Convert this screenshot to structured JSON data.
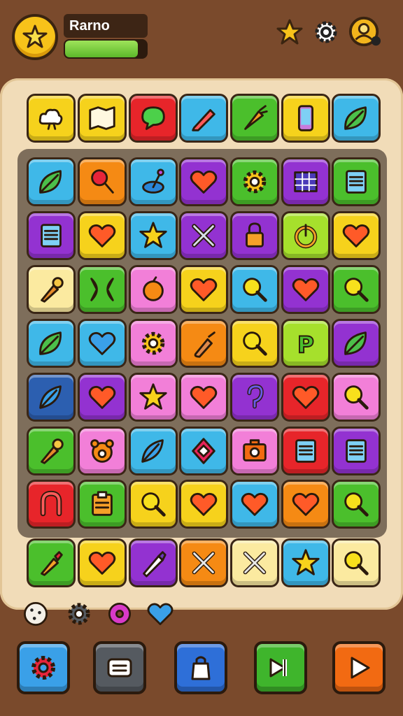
{
  "player": {
    "name": "Rarno",
    "xp_progress": 0.9
  },
  "colors": {
    "yellow": "#f6d21c",
    "cream": "#fbeaa0",
    "red": "#e7252a",
    "blue": "#3fb8e8",
    "green": "#4bbf2c",
    "orange": "#f58a14",
    "purple": "#9332d1",
    "pink": "#f27fd8",
    "lime": "#a6e02c",
    "navy": "#2c5fb0"
  },
  "top_icons": [
    "star-icon",
    "gear-icon",
    "profile-icon"
  ],
  "board": {
    "top_row": [
      {
        "color": "yellow",
        "icon": "cloud-icon"
      },
      {
        "color": "yellow",
        "icon": "map-icon"
      },
      {
        "color": "red",
        "icon": "speech-bubble-icon"
      },
      {
        "color": "blue",
        "icon": "pencil-icon"
      },
      {
        "color": "green",
        "icon": "carrot-icon"
      },
      {
        "color": "yellow",
        "icon": "phone-icon"
      },
      {
        "color": "blue",
        "icon": "leaf-icon"
      }
    ],
    "grid": [
      [
        {
          "color": "blue",
          "icon": "leaf-icon"
        },
        {
          "color": "orange",
          "icon": "lollipop-icon"
        },
        {
          "color": "blue",
          "icon": "joystick-icon"
        },
        {
          "color": "purple",
          "icon": "heart-icon"
        },
        {
          "color": "green",
          "icon": "gear-icon"
        },
        {
          "color": "purple",
          "icon": "window-icon"
        },
        {
          "color": "green",
          "icon": "notepad-icon"
        }
      ],
      [
        {
          "color": "purple",
          "icon": "notepad-icon"
        },
        {
          "color": "yellow",
          "icon": "heart-icon"
        },
        {
          "color": "blue",
          "icon": "star-icon"
        },
        {
          "color": "purple",
          "icon": "swords-icon"
        },
        {
          "color": "purple",
          "icon": "lock-icon"
        },
        {
          "color": "lime",
          "icon": "power-icon"
        },
        {
          "color": "yellow",
          "icon": "heart-icon"
        }
      ],
      [
        {
          "color": "cream",
          "icon": "torch-icon"
        },
        {
          "color": "green",
          "icon": "bow-icon"
        },
        {
          "color": "pink",
          "icon": "orange-fruit-icon"
        },
        {
          "color": "yellow",
          "icon": "heart-icon"
        },
        {
          "color": "blue",
          "icon": "magnifier-icon"
        },
        {
          "color": "purple",
          "icon": "heart-icon"
        },
        {
          "color": "green",
          "icon": "magnifier-icon"
        }
      ],
      [
        {
          "color": "blue",
          "icon": "leaf-icon"
        },
        {
          "color": "blue",
          "icon": "heart-outline-icon"
        },
        {
          "color": "pink",
          "icon": "gear-icon"
        },
        {
          "color": "orange",
          "icon": "bottle-icon"
        },
        {
          "color": "yellow",
          "icon": "magnifier-icon"
        },
        {
          "color": "lime",
          "icon": "letter-p-icon"
        },
        {
          "color": "purple",
          "icon": "leaf-icon"
        }
      ],
      [
        {
          "color": "navy",
          "icon": "feather-icon"
        },
        {
          "color": "purple",
          "icon": "heart-icon"
        },
        {
          "color": "pink",
          "icon": "star-icon"
        },
        {
          "color": "pink",
          "icon": "heart-icon"
        },
        {
          "color": "purple",
          "icon": "hook-icon"
        },
        {
          "color": "red",
          "icon": "heart-icon"
        },
        {
          "color": "pink",
          "icon": "magnifier-icon"
        }
      ],
      [
        {
          "color": "green",
          "icon": "torch-icon"
        },
        {
          "color": "pink",
          "icon": "bear-icon"
        },
        {
          "color": "blue",
          "icon": "feather-icon"
        },
        {
          "color": "blue",
          "icon": "diamond-icon"
        },
        {
          "color": "pink",
          "icon": "camera-icon"
        },
        {
          "color": "red",
          "icon": "notepad-icon"
        },
        {
          "color": "purple",
          "icon": "notepad-icon"
        }
      ],
      [
        {
          "color": "red",
          "icon": "magnet-icon"
        },
        {
          "color": "green",
          "icon": "clipboard-icon"
        },
        {
          "color": "yellow",
          "icon": "magnifier-icon"
        },
        {
          "color": "yellow",
          "icon": "heart-icon"
        },
        {
          "color": "blue",
          "icon": "heart-icon"
        },
        {
          "color": "orange",
          "icon": "heart-icon"
        },
        {
          "color": "green",
          "icon": "magnifier-icon"
        }
      ]
    ],
    "bottom_row": [
      {
        "color": "green",
        "icon": "brush-icon"
      },
      {
        "color": "yellow",
        "icon": "heart-icon"
      },
      {
        "color": "purple",
        "icon": "pen-icon"
      },
      {
        "color": "orange",
        "icon": "tools-icon"
      },
      {
        "color": "cream",
        "icon": "tools-icon"
      },
      {
        "color": "blue",
        "icon": "star-icon"
      },
      {
        "color": "cream",
        "icon": "magnifier-icon"
      }
    ]
  },
  "tray": [
    "cookie-icon",
    "gear-icon",
    "donut-icon",
    "heart-icon"
  ],
  "buttons": [
    {
      "name": "settings-button",
      "color": "#3aa0e8",
      "icon": "gear-icon"
    },
    {
      "name": "menu-button",
      "color": "#555a60",
      "icon": "menu-icon"
    },
    {
      "name": "shop-button",
      "color": "#2e6fd8",
      "icon": "bag-icon"
    },
    {
      "name": "skip-button",
      "color": "#3fb52c",
      "icon": "skip-icon"
    },
    {
      "name": "play-button",
      "color": "#f26a12",
      "icon": "play-icon"
    }
  ]
}
